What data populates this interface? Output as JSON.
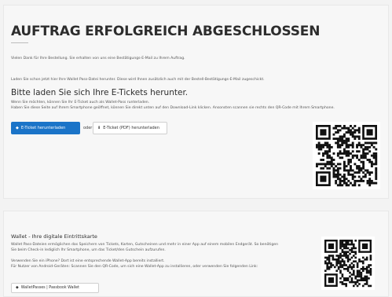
{
  "header": {
    "title": "AUFTRAG ERFOLGREICH ABGESCHLOSSEN"
  },
  "intro": {
    "thanks": "Vielen Dank für Ihre Bestellung. Sie erhalten von uns eine Bestätigungs-E-Mail zu Ihrem Auftrag.",
    "walletpass_hint": "Laden Sie schon jetzt hier Ihre Wallet Pass-Datei herunter. Diese wird Ihnen zusätzlich auch mit der Bestell-Bestätigungs-E-Mail zugeschickt."
  },
  "tickets": {
    "heading": "Bitte laden Sie sich Ihre E-Tickets herunter.",
    "desc_line1": "Wenn Sie möchten, können Sie Ihr E-Ticket auch als Wallet-Pass runterladen.",
    "desc_line2": "Haben Sie diese Seite auf Ihrem Smartphone geöffnet, können Sie direkt unten auf den Download-Link klicken. Ansonsten scannen sie rechts den QR-Code mit Ihrem Smartphone.",
    "primary_button": "E-Ticket herunterladen",
    "oder": "oder",
    "pdf_button": "E-Ticket (PDF) herunterladen",
    "primary_icon": "ticket-icon",
    "pdf_icon": "download-icon"
  },
  "wallet": {
    "heading": "Wallet - Ihre digitale Eintrittskarte",
    "desc_line1": "Wallet Pass-Dateien ermöglichen das Speichern von Tickets, Karten, Gutscheinen und mehr in einer App auf einem mobilen Endgerät. So benötigen",
    "desc_line2": "Sie beim Check-in lediglich Ihr Smartphone, um das Ticket/den Gutschein aufzurufen.",
    "desc_line3": "Verwenden Sie ein iPhone? Dort ist eine entsprechende Wallet-App bereits installiert.",
    "desc_line4": "Für Nutzer von Android-Geräten: Scannen Sie den QR-Code, um sich eine Wallet-App zu installieren, oder verwenden Sie folgenden Link:",
    "button": "WalletPasses | Passbook Wallet",
    "button_icon": "diamond-icon"
  },
  "colors": {
    "primary": "#1b74c8",
    "background": "#f3f3f3"
  }
}
